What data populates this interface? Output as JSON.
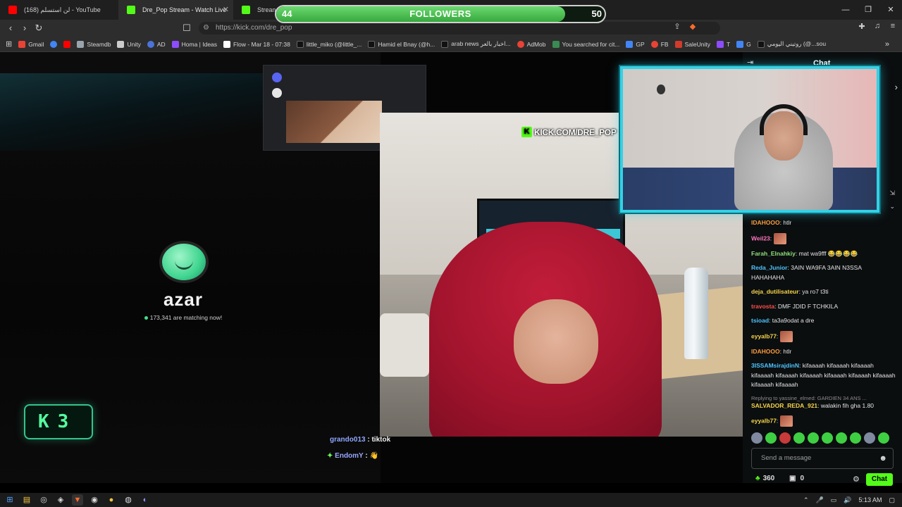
{
  "tabs": [
    {
      "title": "(168) لن استسلم - YouTube",
      "color": "#ff0000",
      "active": false
    },
    {
      "title": "Dre_Pop Stream - Watch Live",
      "color": "#53fc18",
      "active": true
    },
    {
      "title": "Stream",
      "color": "#53fc18",
      "active": false
    }
  ],
  "address": {
    "url": "https://kick.com/dre_pop"
  },
  "bookmarks": [
    {
      "label": "Gmail",
      "color": "#ea4335"
    },
    {
      "label": "",
      "color": "#4285f4"
    },
    {
      "label": "",
      "color": "#ff0000"
    },
    {
      "label": "Steamdb",
      "color": "#9aa4ad"
    },
    {
      "label": "Unity",
      "color": "#cccccc"
    },
    {
      "label": "AD",
      "color": "#4a74d8"
    },
    {
      "label": "Homa | Ideas",
      "color": "#8e4cff"
    },
    {
      "label": "Flow - Mar 18 - 07:38",
      "color": "#ffffff"
    },
    {
      "label": "little_miko (@little_...",
      "color": "#111111"
    },
    {
      "label": "Hamid el Bnay (@h...",
      "color": "#111111"
    },
    {
      "label": "arab news اخبار بالعر...",
      "color": "#111111"
    },
    {
      "label": "AdMob",
      "color": "#ea4335"
    },
    {
      "label": "You searched for cit...",
      "color": "#3a8a52"
    },
    {
      "label": "GP",
      "color": "#4285f4"
    },
    {
      "label": "FB",
      "color": "#ea4335"
    },
    {
      "label": "SaleUnity",
      "color": "#d03b2b"
    },
    {
      "label": "T",
      "color": "#8e4cff"
    },
    {
      "label": "G",
      "color": "#4285f4"
    },
    {
      "label": "روتيني اليومي (@...sou",
      "color": "#111111"
    }
  ],
  "followers_goal": {
    "current": "44",
    "label": "FOLLOWERS",
    "goal": "50",
    "progress": 0.88
  },
  "watermark": {
    "text": "KICK.COM/DRE_POP",
    "logo": "K"
  },
  "azar": {
    "name": "azar",
    "matching": "173,341 are matching now!"
  },
  "kick_badge": {
    "letter": "K",
    "count": "3"
  },
  "overlay_chat": [
    {
      "user": "grando013",
      "text": ": tiktok"
    },
    {
      "user": "EndomY",
      "text": ":"
    }
  ],
  "chat": {
    "title": "Chat",
    "messages": [
      {
        "user": "IDAHOOO",
        "color": "#ff9b3b",
        "text": "htlr",
        "emote": false
      },
      {
        "user": "Weil23",
        "color": "#ff76c0",
        "text": "",
        "emote": true
      },
      {
        "user": "Farah_Elnahkiy",
        "color": "#8fe07a",
        "text": "mat wa9fff 😂😂😂😂",
        "emote": false
      },
      {
        "user": "Reda_Junior",
        "color": "#4ec4ff",
        "text": "3AIN WA9FA 3AIN N3SSA HAHAHAHA",
        "emote": false
      },
      {
        "user": "deja_dutilisateur",
        "color": "#f5d34a",
        "text": "ya ro7 t3ti",
        "emote": false
      },
      {
        "user": "travosta",
        "color": "#ff4d4d",
        "text": "DMF JDID F TCHKILA",
        "emote": false
      },
      {
        "user": "tsioad",
        "color": "#4ec4ff",
        "text": "ta3a9odat a dre",
        "emote": false
      },
      {
        "user": "eyyalb77",
        "color": "#f5d34a",
        "text": "",
        "emote": true
      },
      {
        "user": "IDAHOOO",
        "color": "#ff9b3b",
        "text": "htlr",
        "emote": false
      },
      {
        "user": "3ISSAMsirajdinN",
        "color": "#4ec4ff",
        "text": "kifaaaah kifaaaah kifaaaah kifaaaah kifaaaah kifaaaah kifaaaah kifaaaah kifaaaah kifaaaah kifaaaah",
        "emote": false
      },
      {
        "user": "SALVADOR_REDA_921",
        "color": "#f5d34a",
        "text": "walakin fih gha 1.80",
        "emote": false,
        "reply": "Replying to yassine_elmed: GARDIEN 34 ANS ..."
      },
      {
        "user": "eyyalb77",
        "color": "#f5d34a",
        "text": "",
        "emote": true
      }
    ],
    "input_placeholder": "Send a message",
    "points": "360",
    "gifts": "0",
    "send_label": "Chat"
  },
  "clock": "5:13 AM"
}
